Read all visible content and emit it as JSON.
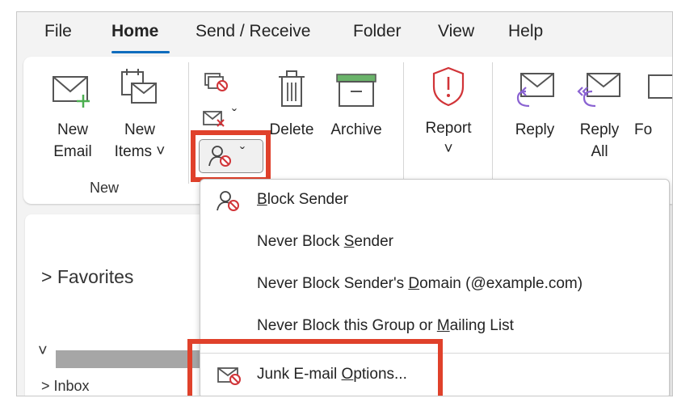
{
  "tabs": [
    "File",
    "Home",
    "Send / Receive",
    "Folder",
    "View",
    "Help"
  ],
  "ribbon": {
    "new_email": [
      "New",
      "Email"
    ],
    "new_items": [
      "New",
      "Items ˅"
    ],
    "group_new": "New",
    "delete": "Delete",
    "archive": "Archive",
    "report": "Report",
    "report_chevron": "˅",
    "reply": "Reply",
    "reply_all": [
      "Reply",
      "All"
    ],
    "forward_partial": "Fo"
  },
  "nav": {
    "favorites": "> Favorites",
    "expand": "˅",
    "inbox": "> Inbox"
  },
  "menu": {
    "block_sender": {
      "pre": "",
      "u": "B",
      "post": "lock Sender"
    },
    "never_block_sender": {
      "pre": "Never Block ",
      "u": "S",
      "post": "ender"
    },
    "never_block_domain": {
      "pre": "Never Block Sender's ",
      "u": "D",
      "post": "omain (@example.com)"
    },
    "never_block_group": {
      "pre": "Never Block this Group or ",
      "u": "M",
      "post": "ailing List"
    },
    "junk_options": {
      "pre": "Junk E-mail ",
      "u": "O",
      "post": "ptions..."
    }
  },
  "colors": {
    "highlight": "#e0412b",
    "accent": "#0f6cbd",
    "danger": "#d13438",
    "reply_purple": "#8a63d2",
    "archive_green": "#6ab36a"
  },
  "icons": [
    "new-email-icon",
    "new-items-icon",
    "ignore-icon",
    "cleanup-icon",
    "junk-icon",
    "delete-icon",
    "archive-icon",
    "report-icon",
    "reply-icon",
    "reply-all-icon",
    "block-sender-icon",
    "junk-options-icon"
  ]
}
